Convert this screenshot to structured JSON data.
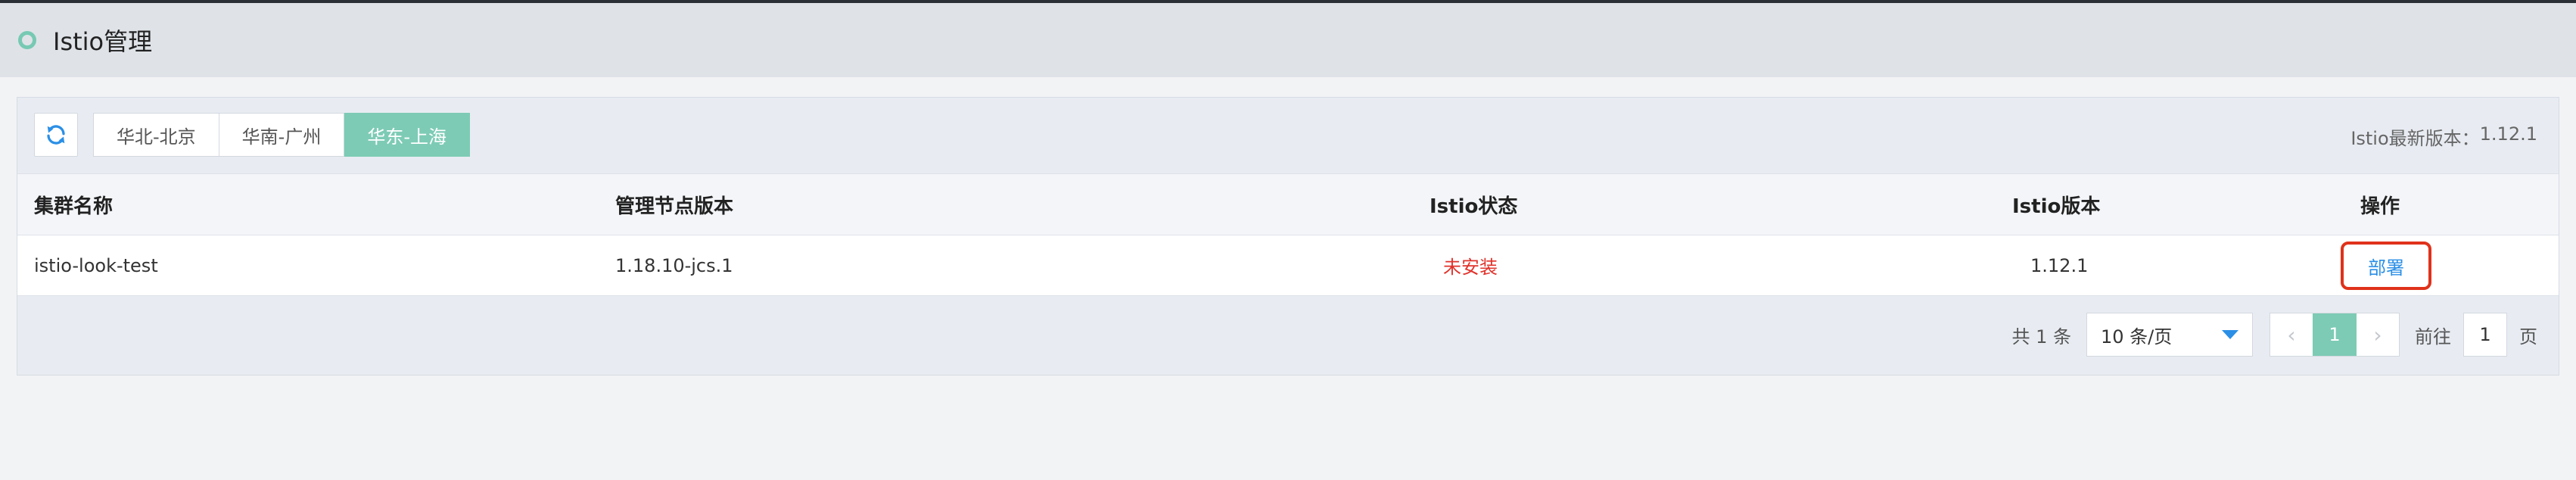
{
  "header": {
    "title": "Istio管理"
  },
  "toolbar": {
    "regions": [
      "华北-北京",
      "华南-广州",
      "华东-上海"
    ],
    "active_region": "华东-上海",
    "latest_label": "Istio最新版本：",
    "latest_version": "1.12.1"
  },
  "table": {
    "columns": [
      "集群名称",
      "管理节点版本",
      "Istio状态",
      "Istio版本",
      "操作"
    ],
    "rows": [
      {
        "name": "istio-look-test",
        "node_version": "1.18.10-jcs.1",
        "status": "未安装",
        "istio_version": "1.12.1",
        "action": "部署"
      }
    ]
  },
  "pagination": {
    "total": "共 1 条",
    "page_size": "10 条/页",
    "current_page": "1",
    "goto_prefix": "前往",
    "goto_value": "1",
    "goto_suffix": "页",
    "prev": "‹",
    "next": "›"
  },
  "colors": {
    "accent": "#7dcbb5",
    "link": "#2b8fe6",
    "danger": "#e0322b",
    "highlight_border": "#e0321b"
  }
}
